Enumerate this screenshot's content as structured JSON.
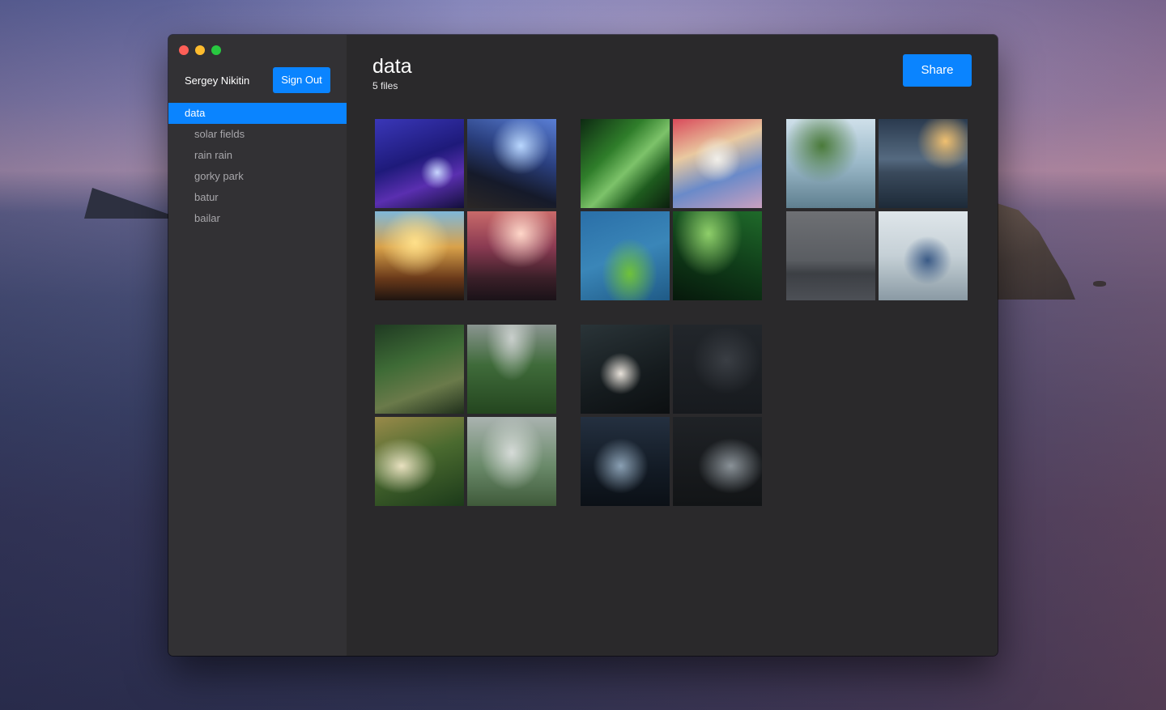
{
  "sidebar": {
    "user_name": "Sergey Nikitin",
    "sign_out_label": "Sign Out",
    "folders": [
      {
        "label": "data",
        "active": true
      },
      {
        "label": "solar fields",
        "active": false
      },
      {
        "label": "rain rain",
        "active": false
      },
      {
        "label": "gorky park",
        "active": false
      },
      {
        "label": "batur",
        "active": false
      },
      {
        "label": "bailar",
        "active": false
      }
    ]
  },
  "main": {
    "title": "data",
    "subtitle": "5 files",
    "share_label": "Share",
    "albums": [
      {
        "name": "album-concert",
        "thumbs": 4
      },
      {
        "name": "album-leaves",
        "thumbs": 4
      },
      {
        "name": "album-river",
        "thumbs": 4
      },
      {
        "name": "album-hills",
        "thumbs": 4
      },
      {
        "name": "album-dancers",
        "thumbs": 4
      }
    ]
  },
  "colors": {
    "accent": "#0a84ff",
    "sidebar_bg": "#323134",
    "main_bg": "#2a292b",
    "traffic_close": "#fe5f57",
    "traffic_minimize": "#febc2e",
    "traffic_zoom": "#28c840"
  }
}
